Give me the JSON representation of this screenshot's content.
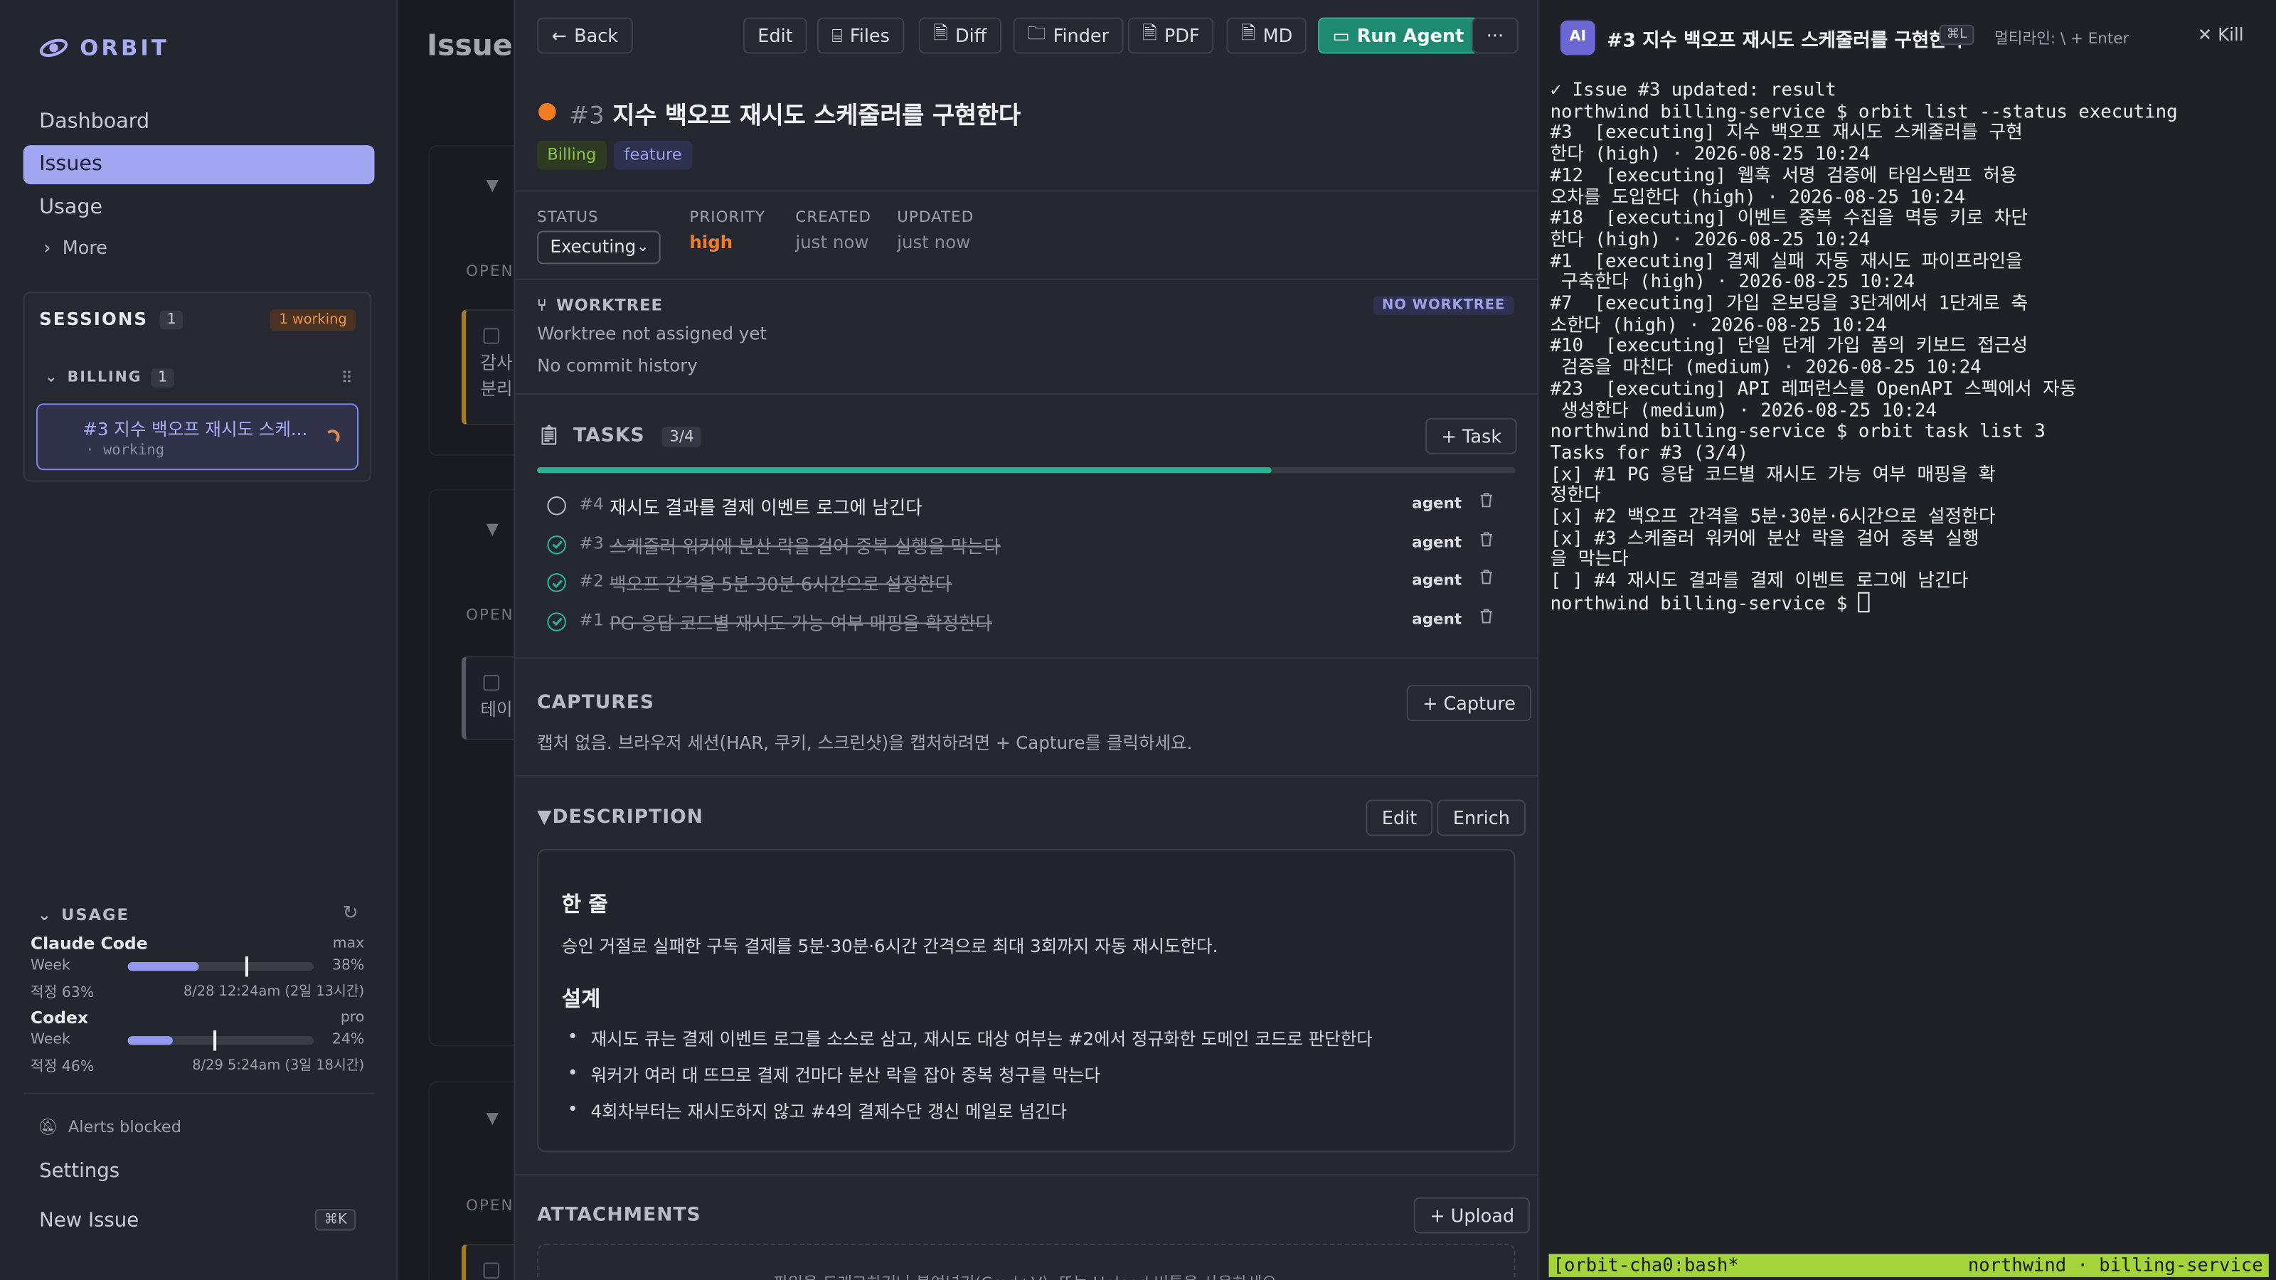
{
  "sidebar": {
    "logo": "ORBIT",
    "nav": [
      "Dashboard",
      "Issues",
      "Usage"
    ],
    "more": "More",
    "sessions_title": "SESSIONS",
    "sessions_count": "1",
    "working_badge": "1 working",
    "group_name": "BILLING",
    "group_count": "1",
    "session_title": "#3 지수 백오프 재시도 스케...",
    "session_status": "· working",
    "usage_title": "USAGE",
    "usage": [
      {
        "name": "Claude Code",
        "plan": "max",
        "period": "Week",
        "pct": "38%",
        "fill": 0.38,
        "marker": 0.63,
        "target": "적정 63%",
        "reset": "8/28 12:24am (2일 13시간)"
      },
      {
        "name": "Codex",
        "plan": "pro",
        "period": "Week",
        "pct": "24%",
        "fill": 0.24,
        "marker": 0.46,
        "target": "적정 46%",
        "reset": "8/29 5:24am (3일 18시간)"
      }
    ],
    "alerts": "Alerts blocked",
    "settings": "Settings",
    "new_issue": "New Issue",
    "new_issue_kbd": "⌘K"
  },
  "issues_list": {
    "title": "Issues",
    "open_label": "OPEN",
    "cards": [
      "감사",
      "분리",
      "테이"
    ]
  },
  "toolbar": {
    "back": "Back",
    "edit": "Edit",
    "files": "Files",
    "diff": "Diff",
    "finder": "Finder",
    "pdf": "PDF",
    "md": "MD",
    "run_agent": "Run Agent",
    "more": "···"
  },
  "issue": {
    "number": "#3",
    "title": "지수 백오프 재시도 스케줄러를 구현한다",
    "tags": [
      {
        "label": "Billing",
        "color": "#8fc34a",
        "bg": "#2f3a23"
      },
      {
        "label": "feature",
        "color": "#9da1e8",
        "bg": "#2f3150"
      }
    ],
    "status_label": "STATUS",
    "status_value": "Executing",
    "priority_label": "PRIORITY",
    "priority_value": "high",
    "created_label": "CREATED",
    "created_value": "just now",
    "updated_label": "UPDATED",
    "updated_value": "just now"
  },
  "worktree": {
    "title": "WORKTREE",
    "badge": "NO WORKTREE",
    "line1": "Worktree not assigned yet",
    "line2": "No commit history"
  },
  "tasks": {
    "title": "TASKS",
    "count": "3/4",
    "progress": 0.75,
    "add_label": "Task",
    "items": [
      {
        "num": "#4",
        "text": "재시도 결과를 결제 이벤트 로그에 남긴다",
        "done": false,
        "agent": "agent"
      },
      {
        "num": "#3",
        "text": "스케줄러 워커에 분산 락을 걸어 중복 실행을 막는다",
        "done": true,
        "agent": "agent"
      },
      {
        "num": "#2",
        "text": "백오프 간격을 5분·30분·6시간으로 설정한다",
        "done": true,
        "agent": "agent"
      },
      {
        "num": "#1",
        "text": "PG 응답 코드별 재시도 가능 여부 매핑을 확정한다",
        "done": true,
        "agent": "agent"
      }
    ]
  },
  "captures": {
    "title": "CAPTURES",
    "button": "+ Capture",
    "empty": "캡처 없음. 브라우저 세션(HAR, 쿠키, 스크린샷)을 캡처하려면 + Capture를 클릭하세요."
  },
  "description": {
    "title": "▼DESCRIPTION",
    "edit": "Edit",
    "enrich": "Enrich",
    "h1": "한 줄",
    "p1": "승인 거절로 실패한 구독 결제를 5분·30분·6시간 간격으로 최대 3회까지 자동 재시도한다.",
    "h2": "설계",
    "bullets": [
      "재시도 큐는 결제 이벤트 로그를 소스로 삼고, 재시도 대상 여부는 #2에서 정규화한 도메인 코드로 판단한다",
      "워커가 여러 대 뜨므로 결제 건마다 분산 락을 잡아 중복 청구를 막는다",
      "4회차부터는 재시도하지 않고 #4의 결제수단 갱신 메일로 넘긴다"
    ]
  },
  "attachments": {
    "title": "ATTACHMENTS",
    "button": "+ Upload",
    "drop": "파일을 드래그하거나 붙여넣기(Cmd+V), 또는 Upload 버튼을 사용하세요."
  },
  "terminal": {
    "badge": "AI",
    "title": "#3 지수 백오프 재시도 스케줄러를 구현한다",
    "kbd": "⌘L",
    "multiline": "멀티라인: \\ + Enter",
    "kill": "Kill",
    "lines": [
      "✓ Issue #3 updated: result",
      "northwind billing-service $ orbit list --status executing",
      "#3  [executing] 지수 백오프 재시도 스케줄러를 구현",
      "한다 (high) · 2026-08-25 10:24",
      "#12  [executing] 웹훅 서명 검증에 타임스탬프 허용",
      "오차를 도입한다 (high) · 2026-08-25 10:24",
      "#18  [executing] 이벤트 중복 수집을 멱등 키로 차단",
      "한다 (high) · 2026-08-25 10:24",
      "#1  [executing] 결제 실패 자동 재시도 파이프라인을",
      " 구축한다 (high) · 2026-08-25 10:24",
      "#7  [executing] 가입 온보딩을 3단계에서 1단계로 축",
      "소한다 (high) · 2026-08-25 10:24",
      "#10  [executing] 단일 단계 가입 폼의 키보드 접근성",
      " 검증을 마친다 (medium) · 2026-08-25 10:24",
      "#23  [executing] API 레퍼런스를 OpenAPI 스펙에서 자동",
      " 생성한다 (medium) · 2026-08-25 10:24",
      "northwind billing-service $ orbit task list 3",
      "Tasks for #3 (3/4)",
      "[x] #1 PG 응답 코드별 재시도 가능 여부 매핑을 확",
      "정한다",
      "[x] #2 백오프 간격을 5분·30분·6시간으로 설정한다",
      "[x] #3 스케줄러 워커에 분산 락을 걸어 중복 실행",
      "을 막는다",
      "[ ] #4 재시도 결과를 결제 이벤트 로그에 남긴다",
      "northwind billing-service $ "
    ],
    "status_left": "[orbit-cha0:bash*",
    "status_right": "northwind · billing-service"
  }
}
